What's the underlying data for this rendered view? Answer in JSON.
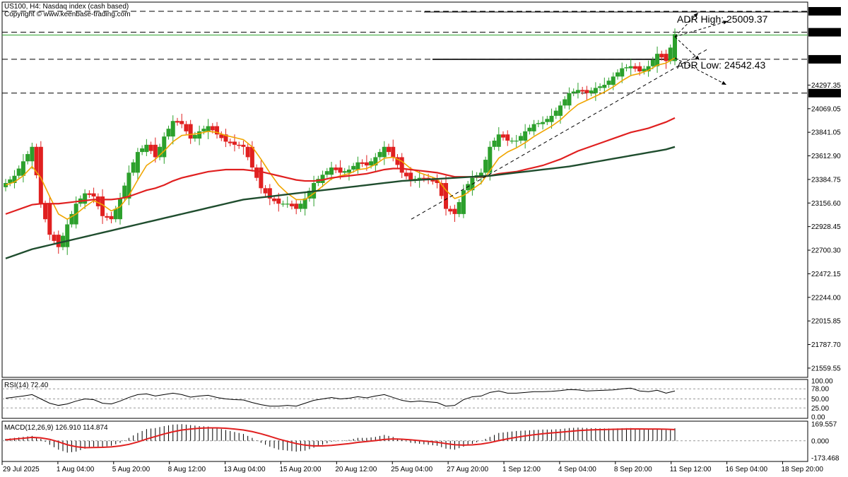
{
  "header": {
    "symbol_line": "US100, H4:  Nasdaq index (cash based)",
    "copyright": "Copyright © www.keenbase-trading.com"
  },
  "colors": {
    "bull": "#2ca02c",
    "bear": "#e02020",
    "ma_fast": "#f0a500",
    "ma_mid": "#e02020",
    "ma_slow": "#1f4d2e",
    "level_line": "#000000",
    "price_box_bg": "#000000"
  },
  "chart_data": [
    {
      "type": "candlestick",
      "title": "US100, H4:  Nasdaq index (cash based)",
      "x_tick_labels": [
        "29 Jul 2025",
        "1 Aug 04:00",
        "5 Aug 20:00",
        "8 Aug 12:00",
        "13 Aug 04:00",
        "15 Aug 20:00",
        "20 Aug 12:00",
        "25 Aug 04:00",
        "27 Aug 20:00",
        "1 Sep 12:00",
        "4 Sep 04:00",
        "8 Sep 20:00",
        "11 Sep 12:00",
        "16 Sep 04:00",
        "18 Sep 20:00"
      ],
      "y_tick_labels": [
        "24297.35",
        "24069.05",
        "23841.05",
        "23612.90",
        "23384.75",
        "23156.60",
        "22928.45",
        "22700.30",
        "22472.15",
        "22244.00",
        "22015.85",
        "21787.70",
        "21559.55"
      ],
      "ylim": [
        21470,
        25100
      ],
      "closes": [
        23350,
        23420,
        23560,
        23700,
        23150,
        22850,
        22730,
        22950,
        23150,
        23250,
        23220,
        23030,
        23000,
        23200,
        23450,
        23650,
        23720,
        23600,
        23800,
        23950,
        23920,
        23780,
        23850,
        23900,
        23820,
        23750,
        23720,
        23700,
        23500,
        23300,
        23200,
        23150,
        23150,
        23100,
        23200,
        23350,
        23430,
        23500,
        23450,
        23480,
        23550,
        23520,
        23600,
        23700,
        23600,
        23450,
        23380,
        23400,
        23380,
        23350,
        23100,
        23050,
        23280,
        23400,
        23450,
        23700,
        23820,
        23760,
        23760,
        23850,
        23920,
        23940,
        24000,
        24100,
        24220,
        24250,
        24220,
        24270,
        24300,
        24380,
        24460,
        24480,
        24430,
        24480,
        24600,
        24530,
        24790
      ],
      "series": [
        {
          "name": "MA fast",
          "values": [
            23330,
            23360,
            23420,
            23510,
            23400,
            23220,
            23050,
            23000,
            23050,
            23120,
            23180,
            23140,
            23080,
            23120,
            23230,
            23380,
            23520,
            23580,
            23660,
            23750,
            23810,
            23820,
            23830,
            23850,
            23840,
            23810,
            23790,
            23770,
            23700,
            23580,
            23450,
            23330,
            23250,
            23190,
            23190,
            23250,
            23320,
            23390,
            23420,
            23440,
            23480,
            23490,
            23530,
            23590,
            23600,
            23560,
            23490,
            23450,
            23420,
            23390,
            23280,
            23200,
            23230,
            23290,
            23350,
            23470,
            23590,
            23650,
            23690,
            23740,
            23800,
            23850,
            23900,
            23960,
            24040,
            24110,
            24150,
            24190,
            24230,
            24280,
            24340,
            24390,
            24410,
            24440,
            24490,
            24510,
            24560
          ]
        },
        {
          "name": "MA mid",
          "values": [
            23050,
            23080,
            23110,
            23140,
            23150,
            23150,
            23150,
            23160,
            23170,
            23180,
            23190,
            23190,
            23190,
            23200,
            23220,
            23250,
            23280,
            23300,
            23330,
            23370,
            23400,
            23420,
            23440,
            23460,
            23470,
            23480,
            23480,
            23480,
            23470,
            23460,
            23440,
            23420,
            23400,
            23380,
            23370,
            23370,
            23380,
            23400,
            23410,
            23420,
            23430,
            23440,
            23460,
            23480,
            23490,
            23490,
            23480,
            23470,
            23460,
            23450,
            23430,
            23410,
            23410,
            23410,
            23410,
            23420,
            23440,
            23450,
            23460,
            23480,
            23500,
            23520,
            23550,
            23580,
            23620,
            23660,
            23690,
            23720,
            23750,
            23780,
            23810,
            23840,
            23860,
            23880,
            23910,
            23940,
            23980
          ]
        },
        {
          "name": "MA slow",
          "values": [
            22620,
            22650,
            22680,
            22710,
            22730,
            22750,
            22770,
            22790,
            22810,
            22830,
            22850,
            22870,
            22890,
            22910,
            22930,
            22950,
            22970,
            22990,
            23010,
            23030,
            23050,
            23070,
            23090,
            23110,
            23130,
            23150,
            23170,
            23190,
            23200,
            23210,
            23220,
            23230,
            23240,
            23250,
            23260,
            23270,
            23280,
            23290,
            23300,
            23310,
            23320,
            23330,
            23340,
            23350,
            23360,
            23370,
            23375,
            23380,
            23385,
            23390,
            23395,
            23400,
            23405,
            23410,
            23415,
            23420,
            23430,
            23440,
            23450,
            23460,
            23470,
            23480,
            23490,
            23500,
            23510,
            23525,
            23540,
            23555,
            23570,
            23585,
            23600,
            23615,
            23630,
            23645,
            23660,
            23675,
            23700
          ]
        }
      ],
      "price_tags": [
        "25011.29",
        "24808.64",
        "24546.78",
        "24219.73"
      ],
      "annotations": {
        "adr_high": "ADR High: 25009.37",
        "adr_low": "ADR Low: 24542.43"
      },
      "grid": false
    },
    {
      "type": "line",
      "title": "RSI(14) 72.40",
      "y_tick_labels": [
        "100.00",
        "78.00",
        "50.00",
        "25.00",
        "0.00"
      ],
      "ylim": [
        0,
        100
      ],
      "values": [
        52,
        55,
        58,
        62,
        50,
        38,
        32,
        36,
        44,
        50,
        48,
        38,
        36,
        44,
        54,
        62,
        64,
        58,
        62,
        66,
        62,
        55,
        58,
        60,
        54,
        50,
        48,
        47,
        40,
        34,
        30,
        30,
        32,
        30,
        38,
        46,
        50,
        54,
        50,
        52,
        56,
        53,
        58,
        62,
        54,
        46,
        42,
        44,
        42,
        40,
        30,
        32,
        48,
        56,
        58,
        68,
        72,
        66,
        66,
        68,
        70,
        70,
        71,
        73,
        76,
        75,
        72,
        73,
        74,
        75,
        78,
        80,
        72,
        70,
        74,
        66,
        72
      ]
    },
    {
      "type": "bar",
      "title": "MACD(12,26,9) 126.910 114.874",
      "y_tick_labels": [
        "169.557",
        "0.000",
        "-173.468"
      ],
      "ylim": [
        -210,
        200
      ],
      "values": [
        20,
        30,
        40,
        50,
        20,
        -40,
        -90,
        -120,
        -110,
        -80,
        -60,
        -60,
        -50,
        -20,
        30,
        80,
        120,
        130,
        150,
        165,
        170,
        160,
        150,
        145,
        130,
        110,
        90,
        70,
        30,
        -20,
        -60,
        -90,
        -100,
        -110,
        -100,
        -70,
        -40,
        -10,
        0,
        10,
        30,
        30,
        40,
        60,
        40,
        10,
        -20,
        -30,
        -40,
        -50,
        -80,
        -90,
        -60,
        -30,
        0,
        40,
        80,
        90,
        100,
        105,
        110,
        115,
        115,
        120,
        130,
        135,
        130,
        128,
        126,
        125,
        128,
        130,
        120,
        115,
        120,
        110,
        127
      ],
      "signal": [
        10,
        18,
        26,
        35,
        30,
        15,
        -10,
        -40,
        -60,
        -70,
        -68,
        -66,
        -62,
        -52,
        -36,
        -12,
        18,
        44,
        70,
        92,
        110,
        120,
        128,
        132,
        132,
        128,
        120,
        110,
        94,
        72,
        46,
        18,
        -6,
        -28,
        -44,
        -52,
        -52,
        -46,
        -37,
        -28,
        -16,
        -7,
        2,
        14,
        19,
        17,
        10,
        2,
        -6,
        -15,
        -28,
        -40,
        -44,
        -41,
        -33,
        -18,
        2,
        20,
        36,
        50,
        62,
        72,
        80,
        88,
        96,
        104,
        109,
        113,
        115,
        117,
        119,
        121,
        121,
        120,
        120,
        118,
        115
      ]
    }
  ]
}
